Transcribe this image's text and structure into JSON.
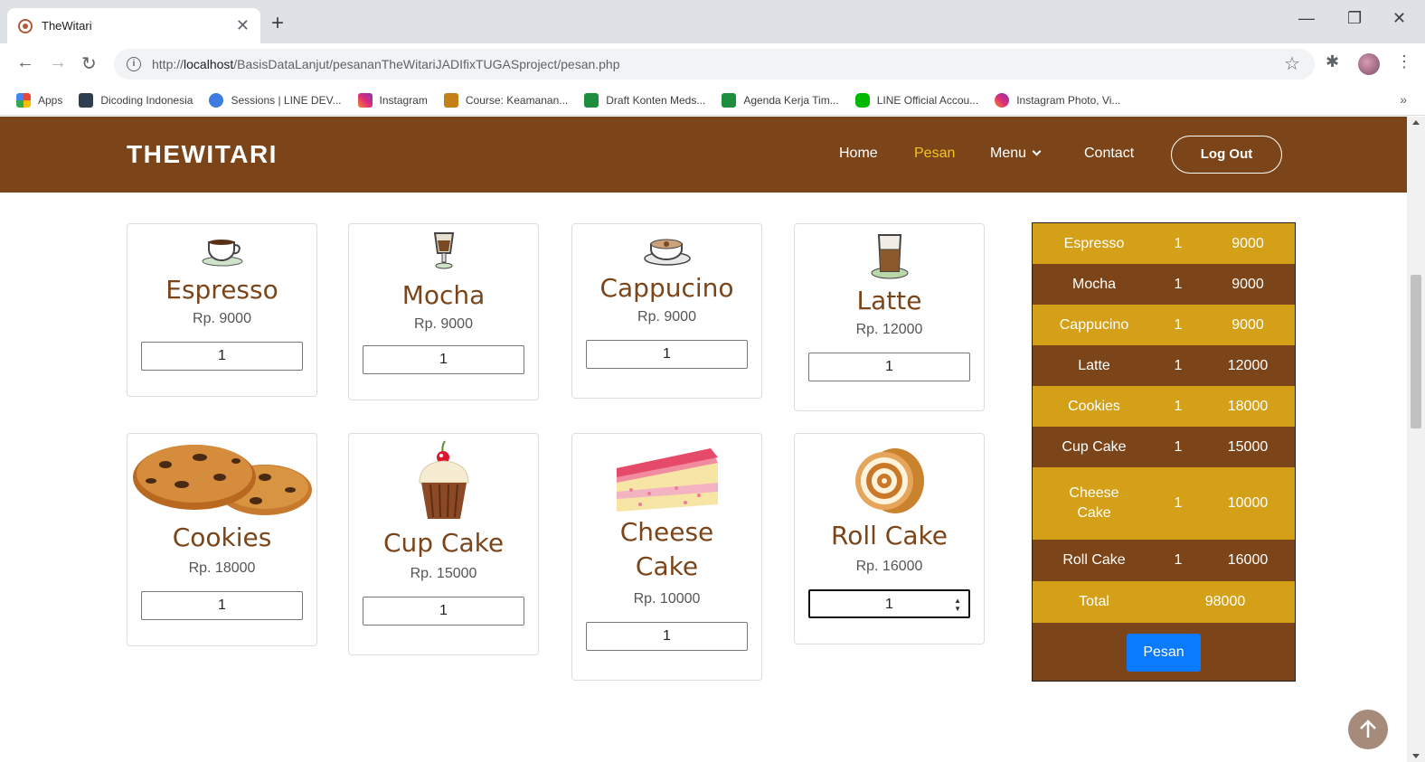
{
  "browser": {
    "tab_title": "TheWitari",
    "url_prefix": "http://",
    "url_host": "localhost",
    "url_path": "/BasisDataLanjut/pesananTheWitariJADIfixTUGASproject/pesan.php",
    "bookmarks": [
      {
        "label": "Apps",
        "color": "#e8453c"
      },
      {
        "label": "Dicoding Indonesia",
        "color": "#2d3e50"
      },
      {
        "label": "Sessions | LINE DEV...",
        "color": "#3d7be0"
      },
      {
        "label": "Instagram",
        "color": "#d6249f"
      },
      {
        "label": "Course: Keamanan...",
        "color": "#c47f17"
      },
      {
        "label": "Draft Konten Meds...",
        "color": "#1e8e3e"
      },
      {
        "label": "Agenda Kerja Tim...",
        "color": "#1e8e3e"
      },
      {
        "label": "LINE Official Accou...",
        "color": "#00b900"
      },
      {
        "label": "Instagram Photo, Vi...",
        "color": "#d6249f"
      }
    ]
  },
  "site": {
    "brand": "THEWITARI",
    "nav": {
      "home": "Home",
      "pesan": "Pesan",
      "menu": "Menu",
      "contact": "Contact",
      "logout": "Log Out"
    }
  },
  "products": [
    {
      "name": "Espresso",
      "price": "Rp. 9000",
      "qty": "1",
      "icon": "espresso-cup-icon"
    },
    {
      "name": "Mocha",
      "price": "Rp. 9000",
      "qty": "1",
      "icon": "mocha-glass-icon"
    },
    {
      "name": "Cappucino",
      "price": "Rp. 9000",
      "qty": "1",
      "icon": "cappuccino-cup-icon"
    },
    {
      "name": "Latte",
      "price": "Rp. 12000",
      "qty": "1",
      "icon": "latte-glass-icon"
    },
    {
      "name": "Cookies",
      "price": "Rp. 18000",
      "qty": "1",
      "icon": "cookies-image"
    },
    {
      "name": "Cup Cake",
      "price": "Rp. 15000",
      "qty": "1",
      "icon": "cupcake-image"
    },
    {
      "name": "Cheese Cake",
      "name_line1": "Cheese",
      "name_line2": "Cake",
      "price": "Rp. 10000",
      "qty": "1",
      "icon": "cheesecake-image"
    },
    {
      "name": "Roll Cake",
      "price": "Rp. 16000",
      "qty": "1",
      "icon": "rollcake-image"
    }
  ],
  "order": {
    "rows": [
      {
        "item": "Espresso",
        "qty": "1",
        "subtotal": "9000"
      },
      {
        "item": "Mocha",
        "qty": "1",
        "subtotal": "9000"
      },
      {
        "item": "Cappucino",
        "qty": "1",
        "subtotal": "9000"
      },
      {
        "item": "Latte",
        "qty": "1",
        "subtotal": "12000"
      },
      {
        "item": "Cookies",
        "qty": "1",
        "subtotal": "18000"
      },
      {
        "item": "Cup Cake",
        "qty": "1",
        "subtotal": "15000"
      },
      {
        "item": "Cheese Cake",
        "item_line1": "Cheese",
        "item_line2": "Cake",
        "qty": "1",
        "subtotal": "10000"
      },
      {
        "item": "Roll Cake",
        "qty": "1",
        "subtotal": "16000"
      }
    ],
    "total_label": "Total",
    "total_value": "98000",
    "submit_label": "Pesan"
  },
  "colors": {
    "brown": "#7b4519",
    "gold": "#d4a017",
    "active_nav": "#f5c518",
    "button_blue": "#0a7bff"
  }
}
